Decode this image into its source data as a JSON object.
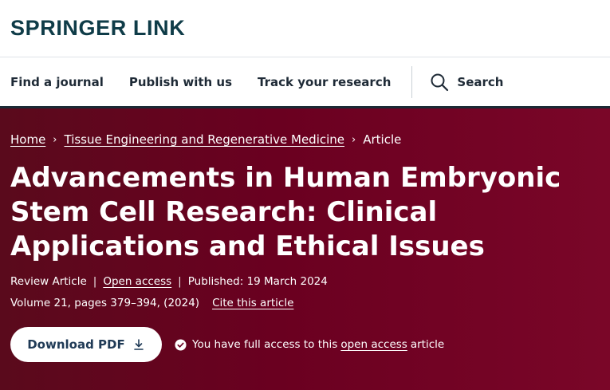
{
  "header": {
    "logo": "SPRINGER LINK"
  },
  "nav": {
    "items": [
      "Find a journal",
      "Publish with us",
      "Track your research"
    ],
    "search_label": "Search"
  },
  "breadcrumb": {
    "home": "Home",
    "journal": "Tissue Engineering and Regenerative Medicine",
    "current": "Article",
    "separator": "›"
  },
  "article": {
    "title": "Advancements in Human Embryonic Stem Cell Research: Clinical Applications and Ethical Issues",
    "type": "Review Article",
    "access": "Open access",
    "published": "Published: 19 March 2024",
    "volume": "Volume 21, pages 379–394, (2024)",
    "cite": "Cite this article"
  },
  "actions": {
    "download_label": "Download PDF",
    "access_text": "You have full access to this",
    "access_link": "open access",
    "access_suffix": "article"
  },
  "colors": {
    "hero_bg": "#6a0020",
    "logo": "#0f3c48",
    "button_text": "#1f3a56"
  }
}
